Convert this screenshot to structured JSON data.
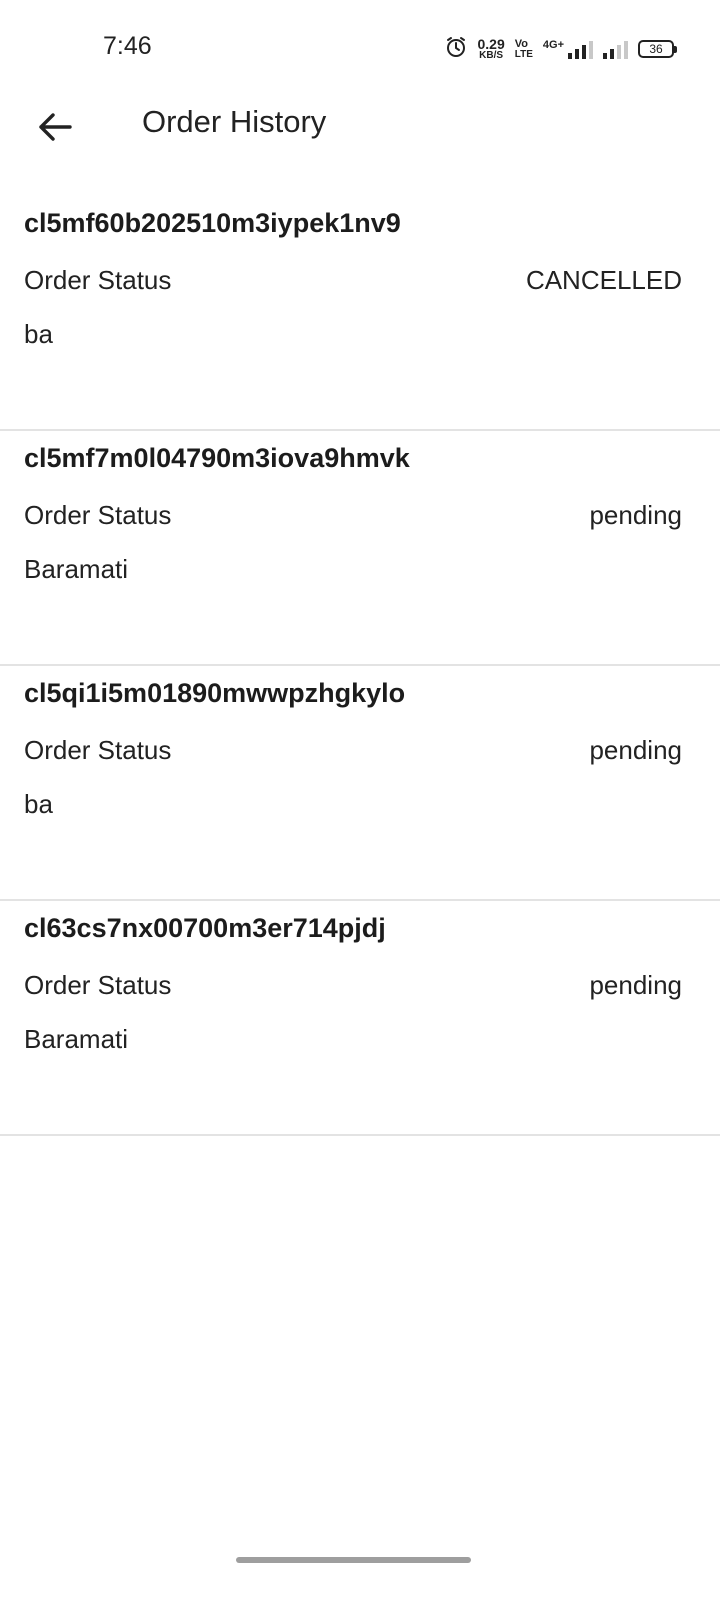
{
  "status_bar": {
    "time": "7:46",
    "net_speed_value": "0.29",
    "net_speed_unit": "KB/S",
    "volte_top": "Vo",
    "volte_bottom": "LTE",
    "network_type": "4G+",
    "battery": "36"
  },
  "header": {
    "back_icon": "arrow-left-icon",
    "title": "Order History"
  },
  "orders": [
    {
      "id": "cl5mf60b202510m3iypek1nv9",
      "status_label": "Order Status",
      "status": "CANCELLED",
      "address": "ba"
    },
    {
      "id": "cl5mf7m0l04790m3iova9hmvk",
      "status_label": "Order Status",
      "status": "pending",
      "address": "Baramati"
    },
    {
      "id": "cl5qi1i5m01890mwwpzhgkylo",
      "status_label": "Order Status",
      "status": "pending",
      "address": "ba"
    },
    {
      "id": "cl63cs7nx00700m3er714pjdj",
      "status_label": "Order Status",
      "status": "pending",
      "address": "Baramati"
    }
  ]
}
